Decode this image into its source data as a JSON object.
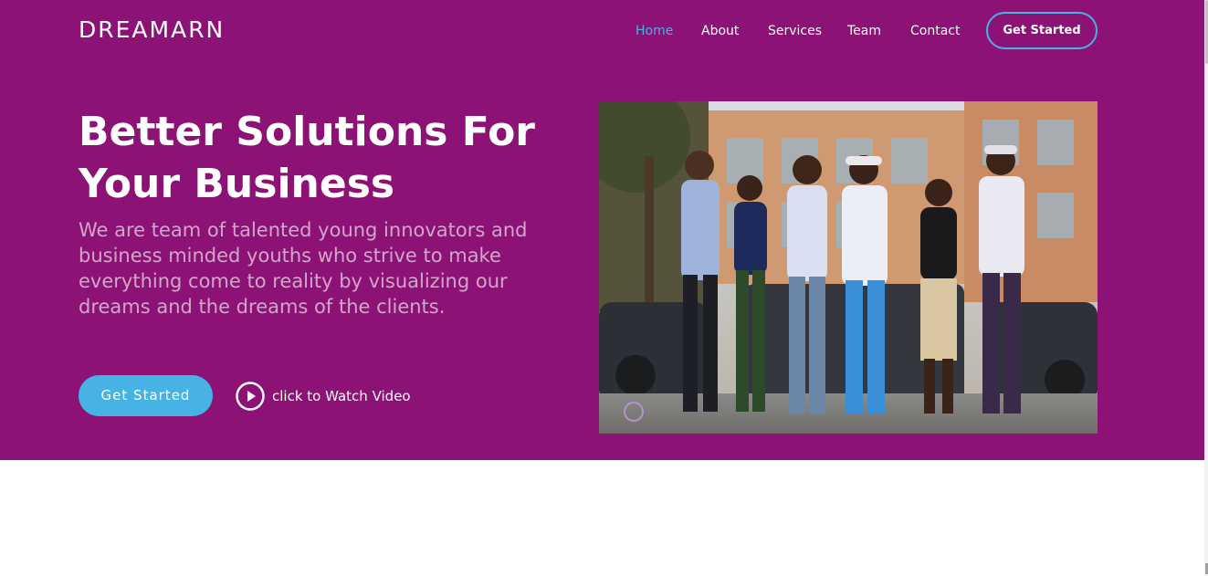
{
  "header": {
    "logo": "DREAMARN",
    "nav": [
      {
        "label": "Home",
        "active": true
      },
      {
        "label": "About",
        "active": false
      },
      {
        "label": "Services",
        "active": false
      },
      {
        "label": "Team",
        "active": false
      },
      {
        "label": "Contact",
        "active": false
      }
    ],
    "cta_label": "Get Started"
  },
  "hero": {
    "title": "Better Solutions For Your Business",
    "subtitle": "We are team of talented young innovators and business minded youths who strive to make everything come to reality by visualizing our dreams and the dreams of the clients.",
    "primary_button": "Get Started",
    "video_link": "click to Watch Video",
    "video_icon": "play-circle-icon",
    "image_description": "team-photo"
  },
  "colors": {
    "hero_background": "#8c1276",
    "accent": "#47b2e4",
    "text": "#ffffff"
  }
}
